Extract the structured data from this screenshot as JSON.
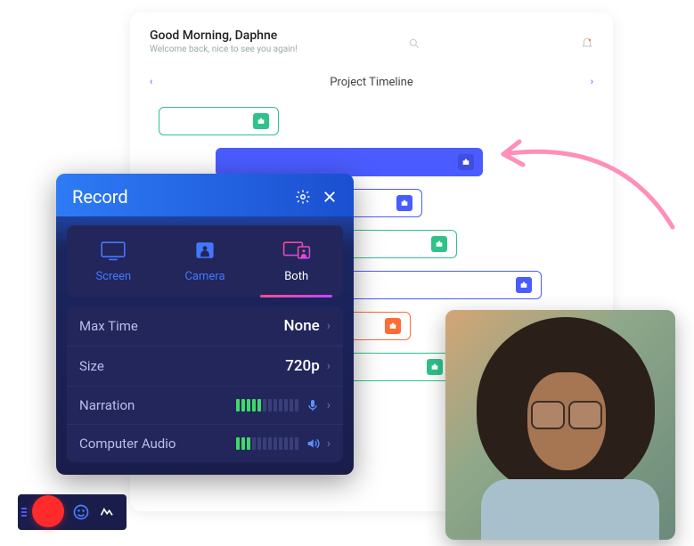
{
  "header": {
    "greeting": "Good Morning, Daphne",
    "subtitle": "Welcome back, nice to see you again!",
    "section_title": "Project Timeline"
  },
  "record": {
    "title": "Record",
    "tabs": {
      "screen": "Screen",
      "camera": "Camera",
      "both": "Both"
    },
    "rows": {
      "max_time_label": "Max Time",
      "max_time_value": "None",
      "size_label": "Size",
      "size_value": "720p",
      "narration_label": "Narration",
      "audio_label": "Computer Audio"
    },
    "narration_level": 5,
    "audio_level": 3,
    "level_total": 12
  }
}
